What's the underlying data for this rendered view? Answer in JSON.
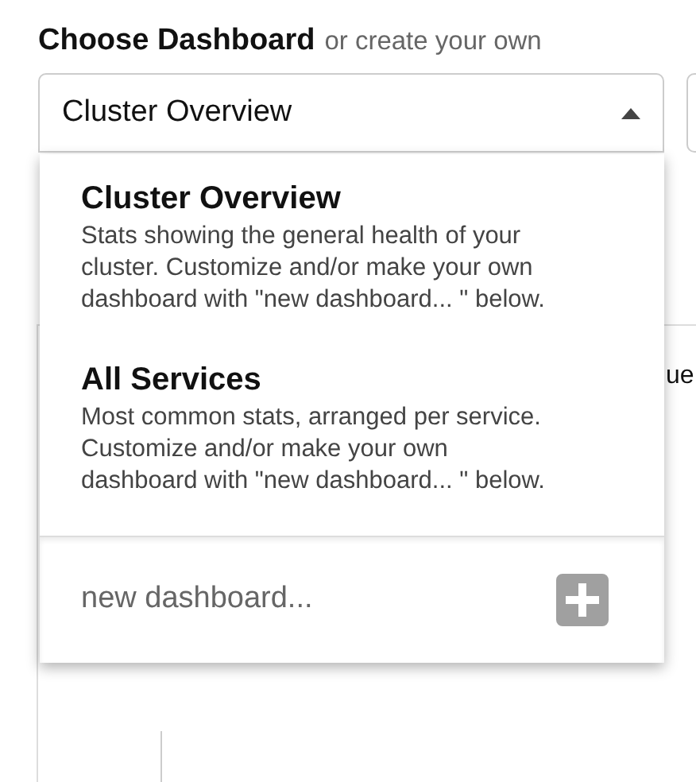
{
  "dashboard_picker": {
    "label": "Choose Dashboard",
    "hint": "or create your own",
    "value": "Cluster Overview",
    "expanded": true,
    "options": [
      {
        "title": "Cluster Overview",
        "description": "Stats showing the general health of your cluster. Customize and/or make your own dashboard with \"new dashboard... \" below."
      },
      {
        "title": "All Services",
        "description": "Most common stats, arranged per service. Customize and/or make your own dashboard with \"new dashboard... \" below."
      }
    ],
    "new_item": {
      "placeholder": "new dashboard..."
    }
  },
  "background_text": "ue"
}
